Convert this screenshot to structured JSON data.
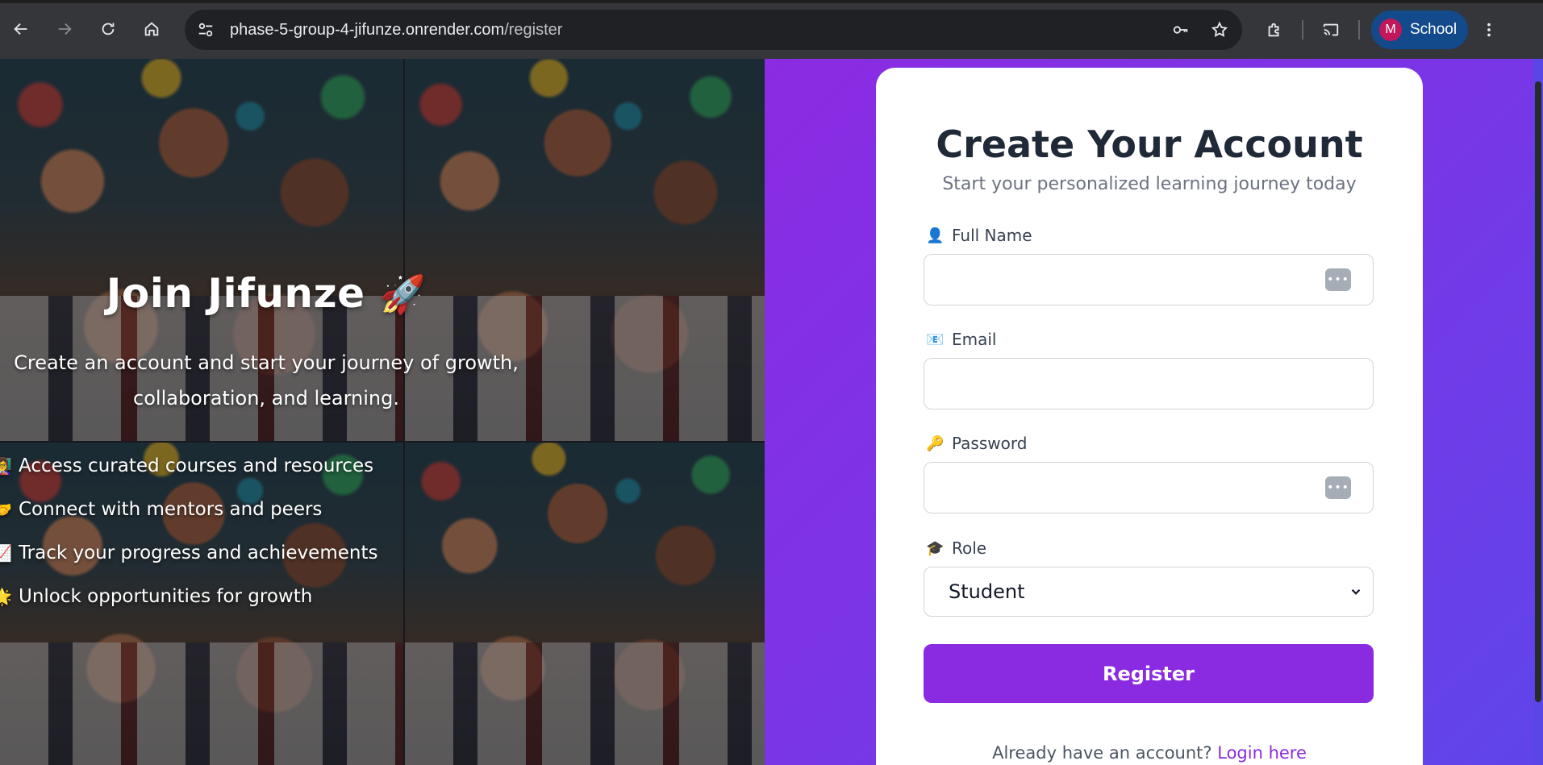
{
  "browser": {
    "url_host": "phase-5-group-4-jifunze.onrender.com",
    "url_path": "/register",
    "profile_initial": "M",
    "profile_name": "School"
  },
  "hero": {
    "title": "Join Jifunze",
    "title_emoji": "🚀",
    "subtitle_line1": "Create an account and start your journey of growth,",
    "subtitle_line2": "collaboration, and learning.",
    "features": [
      {
        "icon": "👩‍🏫",
        "text": "Access curated courses and resources"
      },
      {
        "icon": "🤝",
        "text": "Connect with mentors and peers"
      },
      {
        "icon": "📈",
        "text": "Track your progress and achievements"
      },
      {
        "icon": "🌟",
        "text": "Unlock opportunities for growth"
      }
    ]
  },
  "form": {
    "title": "Create Your Account",
    "subtitle": "Start your personalized learning journey today",
    "fields": {
      "full_name": {
        "icon": "👤",
        "label": "Full Name",
        "value": ""
      },
      "email": {
        "icon": "📧",
        "label": "Email",
        "value": ""
      },
      "password": {
        "icon": "🔑",
        "label": "Password",
        "value": ""
      },
      "role": {
        "icon": "🎓",
        "label": "Role",
        "value": "Student"
      }
    },
    "register_label": "Register",
    "login_prompt": "Already have an account?",
    "login_link": "Login here"
  },
  "colors": {
    "accent": "#8a2be2",
    "gradient_end": "#5f45ea"
  }
}
